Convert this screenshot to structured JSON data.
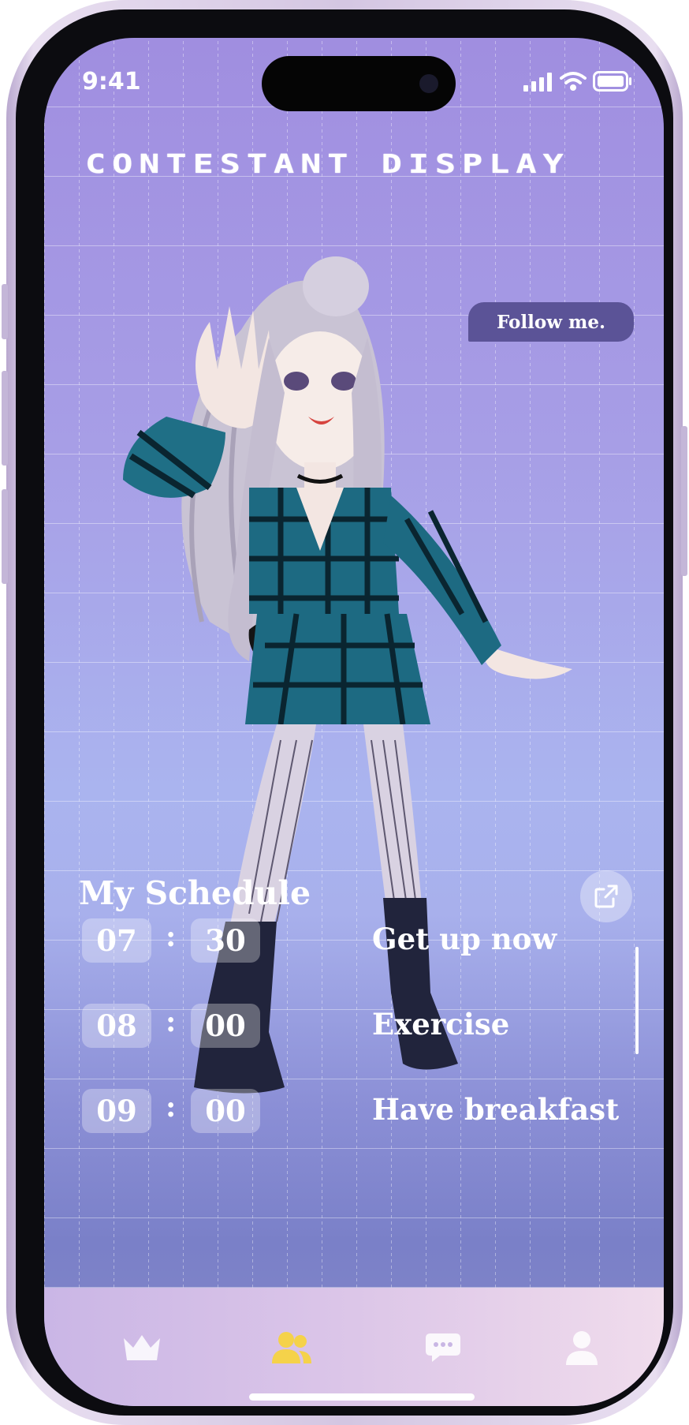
{
  "status_bar": {
    "time": "9:41"
  },
  "header": {
    "title": "CONTESTANT DISPLAY"
  },
  "bubble": {
    "text": "Follow me."
  },
  "schedule": {
    "title": "My Schedule",
    "items": [
      {
        "hour": "07",
        "minute": "30",
        "separator": ":",
        "task": "Get up now"
      },
      {
        "hour": "08",
        "minute": "00",
        "separator": ":",
        "task": "Exercise"
      },
      {
        "hour": "09",
        "minute": "00",
        "separator": ":",
        "task": "Have breakfast"
      }
    ]
  },
  "tab_bar": {
    "tabs": [
      {
        "icon": "crown-icon",
        "active": false
      },
      {
        "icon": "people-icon",
        "active": true
      },
      {
        "icon": "chat-icon",
        "active": false
      },
      {
        "icon": "profile-icon",
        "active": false
      }
    ],
    "active_color": "#f5d24a",
    "inactive_color": "#ffffff"
  },
  "colors": {
    "bubble": "#5b5397",
    "background_top": "#a08ee0",
    "background_bottom": "#8688c9"
  }
}
